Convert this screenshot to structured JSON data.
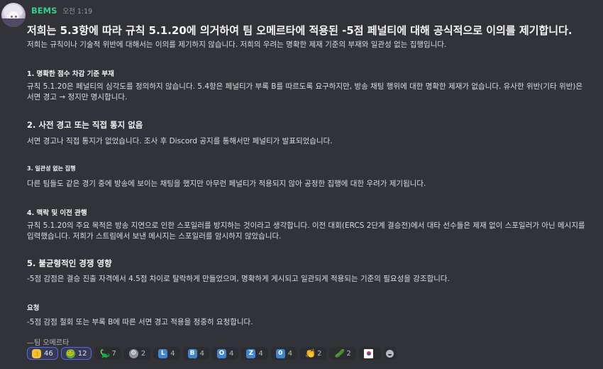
{
  "message": {
    "username": "BEMS",
    "timestamp": "오전 1:19",
    "title": "저희는 5.3항에 따라 규칙 5.1.20에 의거하여 팀 오메르타에 적용된 -5점 페널티에 대해 공식적으로 이의를 제기합니다.",
    "intro": "저희는 규칙이나 기술적 위반에 대해서는 이의를 제기하지 않습니다. 저희의 우려는 명확한 제재 기준의 부재와 일관성 없는 집행입니다.",
    "sections": [
      {
        "heading": "1. 명확한 점수 차감 기준 부재",
        "body": "규칙 5.1.20은 페널티의 심각도를 정의하지 않습니다. 5.4항은 페널티가 부록 B를 따르도록 요구하지만, 방송 채팅 행위에 대한 명확한 제재가 없습니다. 유사한 위반(기타 위반)은 서면 경고 → 정지만 명시합니다."
      },
      {
        "heading": "2. 사전 경고 또는 직접 통지 없음",
        "body": "서면 경고나 직접 통지가 없었습니다. 조사 후 Discord 공지를 통해서만 페널티가 발표되었습니다."
      },
      {
        "heading": "3. 일관성 없는 집행",
        "body": "다른 팀들도 같은 경기 중에 방송에 보이는 채팅을 했지만 아무런 페널티가 적용되지 않아 공정한 집행에 대한 우려가 제기됩니다."
      },
      {
        "heading": "4. 맥락 및 이전 관행",
        "body": "규칙 5.1.20의 주요 목적은 방송 지연으로 인한 스포일러를 방지하는 것이라고 생각합니다. 이전 대회(ERCS 2단계 결승전)에서 대타 선수들은 제재 없이 스포일러가 아닌 메시지를 입력했습니다. 저희가 스트림에서 보낸 메시지는 스포일러를 암시하지 않았습니다."
      },
      {
        "heading": "5. 불균형적인 경쟁 영향",
        "body": "-5점 감점은 결승 진출 자격에서 4.5점 차이로 탈락하게 만들었으며, 명확하게 게시되고 일관되게 적용되는 기준의 필요성을 강조합니다."
      }
    ],
    "request_heading": "요청",
    "request_body": "-5점 감점 철회 또는 부록 B에 따른 서면 경고 적용을 정중히 요청합니다.",
    "signature": "—팀 오메르타"
  },
  "reactions": [
    {
      "icon": "thumbs-up",
      "glyph": "",
      "count": "46",
      "active": true
    },
    {
      "icon": "frog",
      "glyph": "",
      "count": "12",
      "active": true
    },
    {
      "icon": "dinosaur",
      "glyph": "🦕",
      "count": "7",
      "active": false
    },
    {
      "icon": "gear",
      "glyph": "⚙",
      "count": "2",
      "active": false
    },
    {
      "icon": "letter-l",
      "glyph": "L",
      "count": "4",
      "active": false
    },
    {
      "icon": "letter-b",
      "glyph": "B",
      "count": "4",
      "active": false
    },
    {
      "icon": "letter-o",
      "glyph": "O",
      "count": "4",
      "active": false
    },
    {
      "icon": "letter-z",
      "glyph": "Z",
      "count": "4",
      "active": false
    },
    {
      "icon": "digit-zero",
      "glyph": "0",
      "count": "4",
      "active": false
    },
    {
      "icon": "clap",
      "glyph": "👏",
      "count": "2",
      "active": false
    },
    {
      "icon": "pickle",
      "glyph": "🥒",
      "count": "2",
      "active": false
    },
    {
      "icon": "south-korea-flag",
      "glyph": "",
      "count": "",
      "active": false
    }
  ]
}
